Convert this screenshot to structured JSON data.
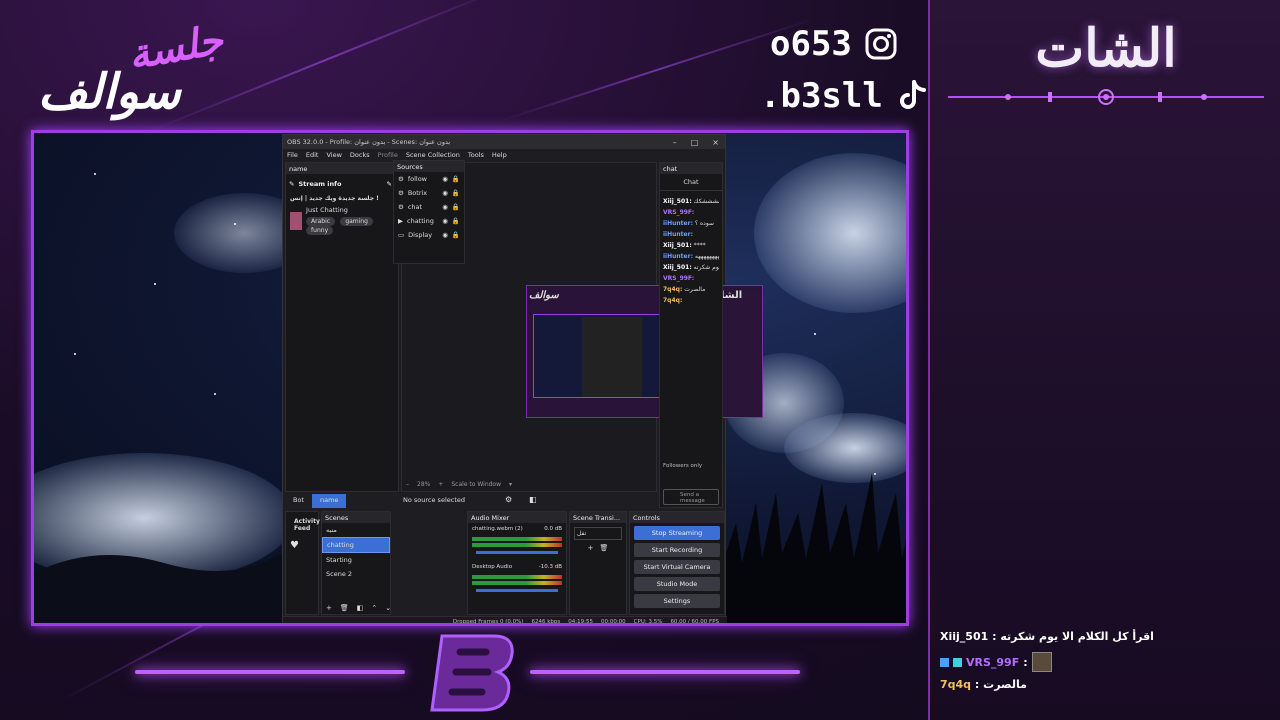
{
  "brand": {
    "name_top": "جلسة",
    "name_bottom": "سوالف"
  },
  "socials": [
    {
      "icon": "instagram-icon",
      "handle": "o653"
    },
    {
      "icon": "tiktok-icon",
      "handle": ".b3sll"
    }
  ],
  "chat_panel": {
    "title": "الشات",
    "messages": [
      {
        "user": "Xiij_501",
        "text": "اقرأ كل الكلام الا يوم شكرته"
      },
      {
        "user": "VRS_99F",
        "text": ""
      },
      {
        "user": "7q4q",
        "text": "مالصرت"
      }
    ]
  },
  "obs": {
    "title": "OBS 32.0.0 - Profile: بدون عنوان - Scenes: بدون عنوان",
    "menu": [
      "File",
      "Edit",
      "View",
      "Docks",
      "Profile",
      "Scene Collection",
      "Tools",
      "Help"
    ],
    "docks": {
      "name_dock": "name",
      "stream_info": {
        "header": "Stream info",
        "title": "جلسة جديدة ويك جديد | إنس !",
        "category": "Just Chatting",
        "tags": [
          "Arabic",
          "gaming",
          "funny"
        ]
      },
      "chat_dock": {
        "header": "chat",
        "tab": "Chat",
        "followers_only": "Followers only",
        "send": "Send a message"
      },
      "bottom_tabs": [
        "Bot",
        "name"
      ],
      "no_source": "No source selected",
      "activity": "Activity Feed",
      "zoom": "28%",
      "scale": "Scale to Window"
    },
    "scenes": {
      "header": "Scenes",
      "items": [
        "منبه",
        "chatting",
        "Starting",
        "Scene 2"
      ],
      "selected": "chatting"
    },
    "sources": {
      "header": "Sources",
      "items": [
        "follow",
        "Botrix",
        "chat",
        "chatting",
        "Display"
      ]
    },
    "audio": {
      "header": "Audio Mixer",
      "channels": [
        {
          "name": "chatting.webm (2)",
          "db": "0.0 dB"
        },
        {
          "name": "Desktop Audio",
          "db": "-10.3 dB"
        }
      ]
    },
    "transitions": {
      "header": "Scene Transi...",
      "value": "تفل"
    },
    "controls": {
      "header": "Controls",
      "buttons": [
        "Stop Streaming",
        "Start Recording",
        "Start Virtual Camera",
        "Studio Mode",
        "Settings"
      ]
    },
    "status": {
      "dropped": "Dropped Frames 0 (0.0%)",
      "kbps": "6246 kbps",
      "time": "04:19:55",
      "rec": "00:00:00",
      "cpu": "CPU: 3.5%",
      "fps": "60.00 / 60.00 FPS"
    },
    "chat_feed": [
      {
        "user": "Xiij_501",
        "text": "رشششششكك",
        "color": "#ffffff"
      },
      {
        "user": "VRS_99F",
        "text": "",
        "color": "#b070ff"
      },
      {
        "user": "iiHunter",
        "text": "سوده ؟",
        "color": "#6aa0ff"
      },
      {
        "user": "iiHunter",
        "text": "",
        "color": "#6aa0ff"
      },
      {
        "user": "Xiij_501",
        "text": "****",
        "color": "#ffffff"
      },
      {
        "user": "iiHunter",
        "text": "ههههههههههههههههه",
        "color": "#6aa0ff"
      },
      {
        "user": "Xiij_501",
        "text": "اقرأ كل الكلام الا يوم شكرته",
        "color": "#ffffff"
      },
      {
        "user": "VRS_99F",
        "text": "",
        "color": "#b070ff"
      },
      {
        "user": "7q4q",
        "text": "مالصرت",
        "color": "#f0c060"
      },
      {
        "user": "7q4q",
        "text": "",
        "color": "#f0c060"
      }
    ]
  },
  "colors": {
    "accent": "#a040ff",
    "obs_primary": "#3b6fd6",
    "panel_bg": "#1d0e29"
  }
}
